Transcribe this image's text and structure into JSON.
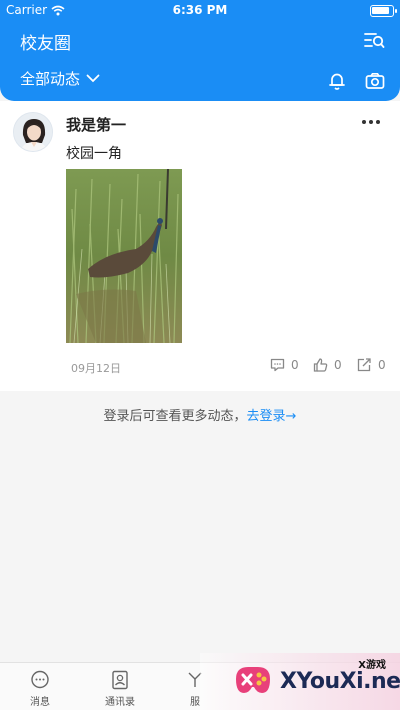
{
  "status_bar": {
    "carrier": "Carrier",
    "time": "6:36 PM"
  },
  "header": {
    "title": "校友圈",
    "filter_label": "全部动态"
  },
  "post": {
    "username": "我是第一",
    "content": "校园一角",
    "date": "09月12日",
    "comment_count": "0",
    "like_count": "0",
    "share_count": "0"
  },
  "login_prompt": {
    "text": "登录后可查看更多动态，",
    "link": "去登录→"
  },
  "tabs": [
    {
      "label": "消息"
    },
    {
      "label": "通讯录"
    },
    {
      "label": "服"
    }
  ],
  "watermark": {
    "small": "X游戏",
    "big": "XYouXi.net"
  },
  "colors": {
    "primary": "#1a8df5",
    "background": "#f5f5f5"
  }
}
